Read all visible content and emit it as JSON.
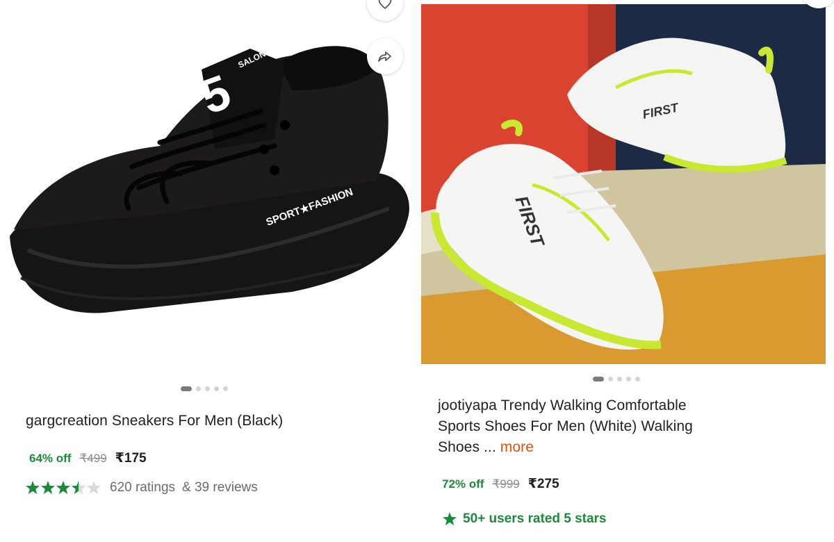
{
  "colors": {
    "discount_green": "#1b8a3a",
    "star_green": "#1b8a3a",
    "more_orange": "#e65100",
    "text_primary": "#212121",
    "text_secondary": "#6b6b6b",
    "mrp_grey": "#8a8a8a"
  },
  "products": [
    {
      "title": "gargcreation Sneakers For Men (Black)",
      "discount": "64% off",
      "mrp": "₹499",
      "price": "₹175",
      "rating_stars": 3.5,
      "ratings_text": "620 ratings",
      "reviews_text": "& 39 reviews",
      "image_dots": 5,
      "image_dot_active": 0,
      "shoe_text_1": "SALON",
      "shoe_text_2": "5",
      "shoe_text_3": "SPORT★FASHION",
      "icons": [
        "heart-icon",
        "share-icon"
      ]
    },
    {
      "title_line1": "jootiyapa Trendy Walking Comfortable",
      "title_line2": "Sports Shoes For Men (White) Walking",
      "title_line3": "Shoes ...",
      "more_label": "more",
      "discount": "72% off",
      "mrp": "₹999",
      "price": "₹275",
      "badge_text": "50+ users rated 5 stars",
      "image_dots": 5,
      "image_dot_active": 0,
      "shoe_text_1": "FIRST",
      "shoe_text_2": "FIRST",
      "icons": [
        "star-icon"
      ]
    }
  ]
}
